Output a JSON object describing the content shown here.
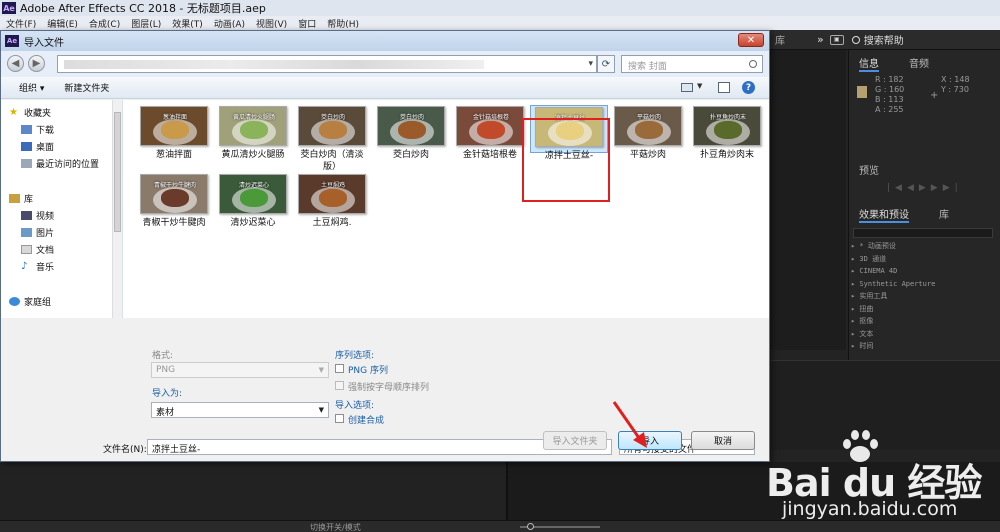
{
  "app": {
    "title": "Adobe After Effects CC 2018 - 无标题项目.aep",
    "logo": "Ae",
    "menu": [
      "文件(F)",
      "编辑(E)",
      "合成(C)",
      "图层(L)",
      "效果(T)",
      "动画(A)",
      "视图(V)",
      "窗口",
      "帮助(H)"
    ]
  },
  "ae_panels": {
    "library_tab": "库",
    "search_help": "搜索帮助",
    "info_tab": "信息",
    "audio_tab": "音频",
    "info_rgba": [
      "R : 182",
      "G : 160",
      "B : 113",
      "A : 255"
    ],
    "info_xy": [
      "X : 148",
      "Y : 730"
    ],
    "swatch_color": "#b6a071",
    "preview_tab": "预览",
    "effects_tab": "效果和预设",
    "effects_lib_tab": "库",
    "effects_items": [
      "▸ * 动画预设",
      "▸ 3D 通道",
      "▸ CINEMA 4D",
      "▸ Synthetic Aperture",
      "▸ 实用工具",
      "▸ 扭曲",
      "▸ 抠像",
      "▸ 文本",
      "▸ 时间"
    ],
    "status_mode": "切换开关/模式"
  },
  "dialog": {
    "title": "导入文件",
    "close": "✕",
    "search_placeholder": "搜索 封面",
    "toolbar": {
      "organize": "组织 ▾",
      "new_folder": "新建文件夹"
    },
    "nav": {
      "favorites": "收藏夹",
      "downloads": "下载",
      "desktop": "桌面",
      "recent": "最近访问的位置",
      "libraries": "库",
      "videos": "视频",
      "pictures": "图片",
      "documents": "文档",
      "music": "音乐",
      "homegroup": "家庭组"
    },
    "files": [
      {
        "name": "葱油拌面",
        "caption": "葱油拌面",
        "food": "#c99a4a"
      },
      {
        "name": "黄瓜清炒火腿肠",
        "caption": "黄瓜清炒火腿肠",
        "food": "#8bb45a"
      },
      {
        "name": "茭白炒肉（清淡版）",
        "caption": "茭白炒肉",
        "food": "#b88040"
      },
      {
        "name": "茭白炒肉",
        "caption": "茭白炒肉",
        "food": "#9a5a2a"
      },
      {
        "name": "金针菇培根卷",
        "caption": "金针菇培根卷",
        "food": "#c04a2a"
      },
      {
        "name": "凉拌土豆丝-",
        "caption": "凉拌土豆丝",
        "food": "#e8d080"
      },
      {
        "name": "平菇炒肉",
        "caption": "平菇炒肉",
        "food": "#9a6a3a"
      },
      {
        "name": "扑豆角炒肉末",
        "caption": "扑豆角炒肉末",
        "food": "#5a6a2a"
      },
      {
        "name": "青椒干炒牛腱肉",
        "caption": "青椒干炒牛腱肉",
        "food": "#6a3a2a"
      },
      {
        "name": "清炒迟菜心",
        "caption": "清炒迟菜心",
        "food": "#4a9a3a"
      },
      {
        "name": "土豆焖鸡.",
        "caption": "土豆焖鸡",
        "food": "#a8602a"
      }
    ],
    "options": {
      "format_label": "格式:",
      "format_value": "PNG",
      "import_as_label": "导入为:",
      "import_as_value": "素材",
      "sequence_label": "序列选项:",
      "png_sequence": "PNG 序列",
      "force_alpha": "强制按字母顺序排列",
      "import_options_label": "导入选项:",
      "create_comp": "创建合成"
    },
    "filename_label": "文件名(N):",
    "filename_value": "凉拌土豆丝-",
    "filetype_value": "所有可接受的文件",
    "buttons": {
      "import_folder": "导入文件夹",
      "import": "导入",
      "cancel": "取消"
    }
  },
  "watermark": {
    "brand": "Bai du 经验",
    "url": "jingyan.baidu.com"
  },
  "colors": {
    "highlight_red": "#e02020",
    "selection_blue": "#cce8ff",
    "ae_dark": "#232323"
  }
}
